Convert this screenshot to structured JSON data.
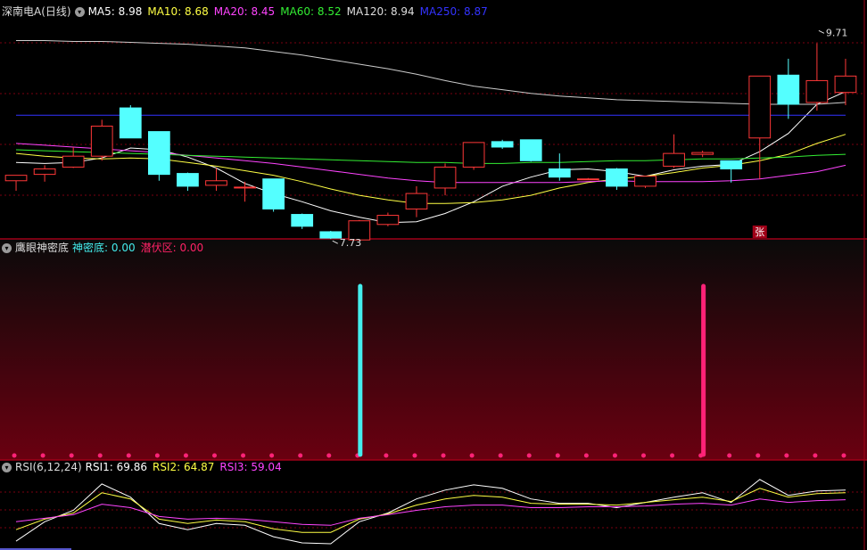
{
  "main_header": {
    "stock_name": "深南电A(日线)",
    "items": [
      {
        "label": "MA5: 8.98",
        "color": "#ffffff"
      },
      {
        "label": "MA10: 8.68",
        "color": "#ffff44"
      },
      {
        "label": "MA20: 8.45",
        "color": "#ff44ff"
      },
      {
        "label": "MA60: 8.52",
        "color": "#33ee33"
      },
      {
        "label": "MA120: 8.94",
        "color": "#dddddd"
      },
      {
        "label": "MA250: 8.87",
        "color": "#3333ff"
      }
    ]
  },
  "indicator_header": {
    "name": "鹰眼神密底",
    "items": [
      {
        "label": "神密底: 0.00",
        "color": "#44eeee"
      },
      {
        "label": "潜伏区: 0.00",
        "color": "#ff2266"
      }
    ]
  },
  "rsi_header": {
    "name": "RSI(6,12,24)",
    "items": [
      {
        "label": "RSI1: 69.86",
        "color": "#ffffff"
      },
      {
        "label": "RSI2: 64.87",
        "color": "#ffff44"
      },
      {
        "label": "RSI3: 59.04",
        "color": "#ff44ff"
      }
    ]
  },
  "chart_data": [
    {
      "type": "candlestick",
      "ylim": [
        7.5,
        9.85
      ],
      "candles": [
        {
          "o": 8.08,
          "h": 8.14,
          "l": 7.97,
          "c": 8.14
        },
        {
          "o": 8.15,
          "h": 8.25,
          "l": 8.07,
          "c": 8.21
        },
        {
          "o": 8.23,
          "h": 8.45,
          "l": 8.22,
          "c": 8.35
        },
        {
          "o": 8.35,
          "h": 8.75,
          "l": 8.3,
          "c": 8.68
        },
        {
          "o": 8.88,
          "h": 8.91,
          "l": 8.55,
          "c": 8.55
        },
        {
          "o": 8.62,
          "h": 8.62,
          "l": 8.08,
          "c": 8.15
        },
        {
          "o": 8.16,
          "h": 8.17,
          "l": 7.97,
          "c": 8.02
        },
        {
          "o": 8.03,
          "h": 8.22,
          "l": 7.97,
          "c": 8.08
        },
        {
          "o": 8.01,
          "h": 8.07,
          "l": 7.85,
          "c": 8.01
        },
        {
          "o": 8.1,
          "h": 8.1,
          "l": 7.74,
          "c": 7.77
        },
        {
          "o": 7.71,
          "h": 7.72,
          "l": 7.55,
          "c": 7.58
        },
        {
          "o": 7.52,
          "h": 7.53,
          "l": 7.44,
          "c": 7.45
        },
        {
          "o": 7.43,
          "h": 7.65,
          "l": 7.42,
          "c": 7.64
        },
        {
          "o": 7.6,
          "h": 7.73,
          "l": 7.58,
          "c": 7.7
        },
        {
          "o": 7.77,
          "h": 8.02,
          "l": 7.68,
          "c": 7.94
        },
        {
          "o": 8.0,
          "h": 8.27,
          "l": 7.92,
          "c": 8.23
        },
        {
          "o": 8.23,
          "h": 8.5,
          "l": 8.2,
          "c": 8.5
        },
        {
          "o": 8.51,
          "h": 8.53,
          "l": 8.43,
          "c": 8.45
        },
        {
          "o": 8.53,
          "h": 8.53,
          "l": 8.29,
          "c": 8.3
        },
        {
          "o": 8.21,
          "h": 8.38,
          "l": 8.08,
          "c": 8.12
        },
        {
          "o": 8.1,
          "h": 8.11,
          "l": 8.09,
          "c": 8.1
        },
        {
          "o": 8.21,
          "h": 8.22,
          "l": 7.98,
          "c": 8.02
        },
        {
          "o": 8.02,
          "h": 8.13,
          "l": 8.0,
          "c": 8.13
        },
        {
          "o": 8.24,
          "h": 8.59,
          "l": 8.22,
          "c": 8.38
        },
        {
          "o": 8.37,
          "h": 8.41,
          "l": 8.34,
          "c": 8.39
        },
        {
          "o": 8.3,
          "h": 8.3,
          "l": 8.06,
          "c": 8.21
        },
        {
          "o": 8.55,
          "h": 9.23,
          "l": 8.1,
          "c": 9.23
        },
        {
          "o": 9.24,
          "h": 9.42,
          "l": 8.76,
          "c": 8.92
        },
        {
          "o": 8.94,
          "h": 9.59,
          "l": 8.85,
          "c": 9.18
        },
        {
          "o": 9.05,
          "h": 9.42,
          "l": 8.91,
          "c": 9.23
        }
      ],
      "ma_series": [
        {
          "name": "MA5",
          "color": "#ffffff",
          "values": [
            8.28,
            8.27,
            8.28,
            8.33,
            8.44,
            8.42,
            8.34,
            8.22,
            8.05,
            7.94,
            7.85,
            7.75,
            7.68,
            7.62,
            7.63,
            7.72,
            7.85,
            8.02,
            8.12,
            8.2,
            8.21,
            8.18,
            8.13,
            8.2,
            8.24,
            8.26,
            8.4,
            8.6,
            8.92,
            9.06
          ]
        },
        {
          "name": "MA10",
          "color": "#ffff44",
          "values": [
            8.38,
            8.35,
            8.33,
            8.32,
            8.33,
            8.32,
            8.28,
            8.24,
            8.19,
            8.14,
            8.07,
            7.99,
            7.92,
            7.87,
            7.83,
            7.83,
            7.84,
            7.87,
            7.92,
            8.0,
            8.06,
            8.1,
            8.13,
            8.17,
            8.22,
            8.25,
            8.3,
            8.37,
            8.49,
            8.59
          ]
        },
        {
          "name": "MA20",
          "color": "#ff44ff",
          "values": [
            8.49,
            8.47,
            8.45,
            8.43,
            8.41,
            8.39,
            8.36,
            8.33,
            8.3,
            8.27,
            8.23,
            8.19,
            8.15,
            8.11,
            8.08,
            8.06,
            8.06,
            8.06,
            8.06,
            8.06,
            8.07,
            8.08,
            8.07,
            8.07,
            8.07,
            8.08,
            8.1,
            8.14,
            8.18,
            8.25
          ]
        },
        {
          "name": "MA60",
          "color": "#33ee33",
          "values": [
            8.42,
            8.41,
            8.4,
            8.39,
            8.38,
            8.37,
            8.36,
            8.35,
            8.34,
            8.33,
            8.32,
            8.31,
            8.3,
            8.29,
            8.28,
            8.28,
            8.27,
            8.27,
            8.28,
            8.28,
            8.29,
            8.3,
            8.3,
            8.31,
            8.32,
            8.32,
            8.33,
            8.34,
            8.36,
            8.37
          ]
        },
        {
          "name": "MA120",
          "color": "#cccccc",
          "values": [
            9.62,
            9.62,
            9.61,
            9.61,
            9.6,
            9.59,
            9.58,
            9.56,
            9.54,
            9.5,
            9.46,
            9.41,
            9.36,
            9.31,
            9.25,
            9.18,
            9.12,
            9.08,
            9.04,
            9.01,
            8.99,
            8.97,
            8.96,
            8.95,
            8.94,
            8.93,
            8.92,
            8.92,
            8.92,
            8.94
          ]
        },
        {
          "name": "MA250",
          "color": "#3333ff",
          "values": [
            8.8,
            8.8,
            8.8,
            8.8,
            8.8,
            8.8,
            8.8,
            8.8,
            8.8,
            8.8,
            8.8,
            8.8,
            8.8,
            8.8,
            8.8,
            8.8,
            8.8,
            8.8,
            8.8,
            8.8,
            8.8,
            8.8,
            8.8,
            8.8,
            8.8,
            8.8,
            8.8,
            8.8,
            8.8,
            8.8
          ]
        }
      ],
      "annotations": [
        {
          "label": "9.71",
          "index": 28,
          "value": 9.71
        },
        {
          "label": "7.73",
          "index": 11,
          "value": 7.4
        }
      ],
      "flag": {
        "label": "张",
        "index": 26
      }
    },
    {
      "type": "bar",
      "name": "鹰眼神密底",
      "signals": [
        {
          "index": 12,
          "color": "#44eeee"
        },
        {
          "index": 24,
          "color": "#ff2277"
        }
      ]
    },
    {
      "type": "line",
      "name": "RSI(6,12,24)",
      "ylim": [
        15,
        95
      ],
      "series": [
        {
          "name": "RSI1",
          "color": "#ffffff",
          "values": [
            20,
            42,
            55,
            85,
            70,
            40,
            33,
            40,
            38,
            25,
            18,
            17,
            42,
            52,
            68,
            78,
            84,
            80,
            68,
            63,
            63,
            58,
            64,
            70,
            75,
            64,
            90,
            72,
            77,
            78
          ]
        },
        {
          "name": "RSI2",
          "color": "#ffff44",
          "values": [
            33,
            45,
            52,
            75,
            68,
            45,
            40,
            44,
            42,
            34,
            30,
            30,
            45,
            51,
            61,
            68,
            72,
            70,
            63,
            62,
            62,
            61,
            64,
            67,
            70,
            65,
            80,
            70,
            74,
            75
          ]
        },
        {
          "name": "RSI3",
          "color": "#ff44ff",
          "values": [
            42,
            46,
            50,
            62,
            58,
            48,
            45,
            46,
            45,
            42,
            39,
            38,
            46,
            50,
            55,
            59,
            61,
            61,
            58,
            58,
            59,
            59,
            60,
            62,
            63,
            61,
            68,
            64,
            66,
            67
          ]
        }
      ]
    }
  ]
}
